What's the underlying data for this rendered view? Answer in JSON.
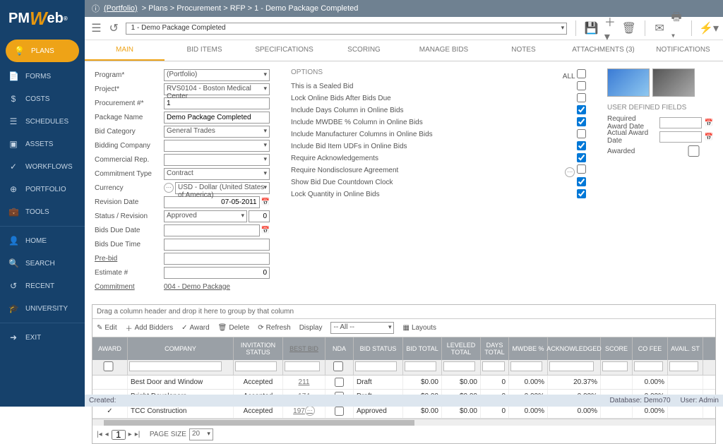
{
  "breadcrumb": {
    "portfolio": "(Portfolio)",
    "path": [
      "Plans",
      "Procurement",
      "RFP",
      "1 - Demo Package Completed"
    ]
  },
  "toolbar": {
    "record": "1 -  Demo Package Completed"
  },
  "sidebar": {
    "items": [
      {
        "label": "PLANS",
        "icon": "💡",
        "active": true
      },
      {
        "label": "FORMS",
        "icon": "📄"
      },
      {
        "label": "COSTS",
        "icon": "$"
      },
      {
        "label": "SCHEDULES",
        "icon": "☰"
      },
      {
        "label": "ASSETS",
        "icon": "▣"
      },
      {
        "label": "WORKFLOWS",
        "icon": "✓"
      },
      {
        "label": "PORTFOLIO",
        "icon": "⊕"
      },
      {
        "label": "TOOLS",
        "icon": "💼"
      },
      {
        "label": "HOME",
        "icon": "👤",
        "sep": true
      },
      {
        "label": "SEARCH",
        "icon": "🔍"
      },
      {
        "label": "RECENT",
        "icon": "↺"
      },
      {
        "label": "UNIVERSITY",
        "icon": "🎓"
      },
      {
        "label": "EXIT",
        "icon": "➜",
        "sep": true
      }
    ]
  },
  "tabs": [
    "MAIN",
    "BID ITEMS",
    "SPECIFICATIONS",
    "SCORING",
    "MANAGE BIDS",
    "NOTES",
    "ATTACHMENTS (3)",
    "NOTIFICATIONS"
  ],
  "form": {
    "rows": [
      {
        "l": "Program*",
        "v": "(Portfolio)",
        "t": "sel"
      },
      {
        "l": "Project*",
        "v": "RVS0104 - Boston Medical Center",
        "t": "sel"
      },
      {
        "l": "Procurement #*",
        "v": "1",
        "t": "in"
      },
      {
        "l": "Package Name",
        "v": "Demo Package Completed",
        "t": "in"
      },
      {
        "l": "Bid Category",
        "v": "General Trades",
        "t": "sel"
      },
      {
        "l": "Bidding Company",
        "v": "",
        "t": "sel"
      },
      {
        "l": "Commercial Rep.",
        "v": "",
        "t": "sel"
      },
      {
        "l": "Commitment Type",
        "v": "Contract",
        "t": "sel"
      },
      {
        "l": "Currency",
        "v": "USD - Dollar (United States of America)",
        "t": "sel",
        "dots": true
      },
      {
        "l": "Revision Date",
        "v": "07-05-2011",
        "t": "in",
        "cal": true,
        "right": true
      },
      {
        "l": "Status / Revision",
        "v": "Approved",
        "t": "selnum",
        "num": "0"
      },
      {
        "l": "Bids Due Date",
        "v": "",
        "t": "in",
        "cal": true
      },
      {
        "l": "Bids Due Time",
        "v": "",
        "t": "in"
      },
      {
        "l": "Pre-bid",
        "v": "",
        "t": "in",
        "u": true
      },
      {
        "l": "Estimate #",
        "v": "0",
        "t": "in",
        "right": true
      },
      {
        "l": "Commitment",
        "v": "004 - Demo Package",
        "t": "txt",
        "u": true
      }
    ]
  },
  "options": {
    "header": "OPTIONS",
    "all": "ALL",
    "rows": [
      {
        "l": "This is a Sealed Bid",
        "c": false
      },
      {
        "l": "Lock Online Bids After Bids Due",
        "c": false
      },
      {
        "l": "Include Days Column in Online Bids",
        "c": true
      },
      {
        "l": "Include MWDBE % Column in Online Bids",
        "c": true
      },
      {
        "l": "Include Manufacturer Columns in Online Bids",
        "c": false
      },
      {
        "l": "Include Bid Item UDFs in Online Bids",
        "c": true
      },
      {
        "l": "Require Acknowledgements",
        "c": true
      },
      {
        "l": "Require Nondisclosure Agreement",
        "c": false,
        "dots": true
      },
      {
        "l": "Show Bid Due Countdown Clock",
        "c": true
      },
      {
        "l": "Lock Quantity in Online Bids",
        "c": true
      }
    ]
  },
  "udf": {
    "header": "USER DEFINED FIELDS",
    "rows": [
      {
        "l": "Required Award Date",
        "t": "date"
      },
      {
        "l": "Actual Award Date",
        "t": "date"
      },
      {
        "l": "Awarded",
        "t": "check"
      }
    ]
  },
  "grid": {
    "dragText": "Drag a column header and drop it here to group by that column",
    "actions": {
      "edit": "Edit",
      "addBidders": "Add Bidders",
      "award": "Award",
      "delete": "Delete",
      "refresh": "Refresh",
      "display": "Display",
      "displaySel": "-- All --",
      "layouts": "Layouts"
    },
    "cols": [
      "AWARD",
      "COMPANY",
      "INVITATION STATUS",
      "BEST BID",
      "NDA",
      "BID STATUS",
      "BID TOTAL",
      "LEVELED TOTAL",
      "DAYS TOTAL",
      "MWDBE %",
      "ACKNOWLEDGED",
      "SCORE",
      "CO FEE",
      "AVAIL. ST"
    ],
    "rows": [
      {
        "award": "",
        "company": "Best Door and Window",
        "inv": "Accepted",
        "best": "211",
        "nda": false,
        "status": "Draft",
        "total": "$0.00",
        "lev": "$0.00",
        "days": "0",
        "mw": "0.00%",
        "ack": "20.37%",
        "score": "",
        "fee": "0.00%"
      },
      {
        "award": "",
        "company": "Bright Developers",
        "inv": "Accepted",
        "best": "174",
        "nda": false,
        "status": "Draft",
        "total": "$0.00",
        "lev": "$0.00",
        "days": "0",
        "mw": "0.00%",
        "ack": "0.00%",
        "score": "",
        "fee": "0.00%"
      },
      {
        "award": "✓",
        "company": "TCC Construction",
        "inv": "Accepted",
        "best": "197",
        "nda": false,
        "status": "Approved",
        "total": "$0.00",
        "lev": "$0.00",
        "days": "0",
        "mw": "0.00%",
        "ack": "0.00%",
        "score": "",
        "fee": "0.00%",
        "dots": true
      }
    ],
    "pager": {
      "page": "1",
      "sizeLabel": "PAGE SIZE",
      "size": "20"
    }
  },
  "status": {
    "created": "Created:",
    "db": "Database:  Demo70",
    "user": "User:  Admin"
  }
}
